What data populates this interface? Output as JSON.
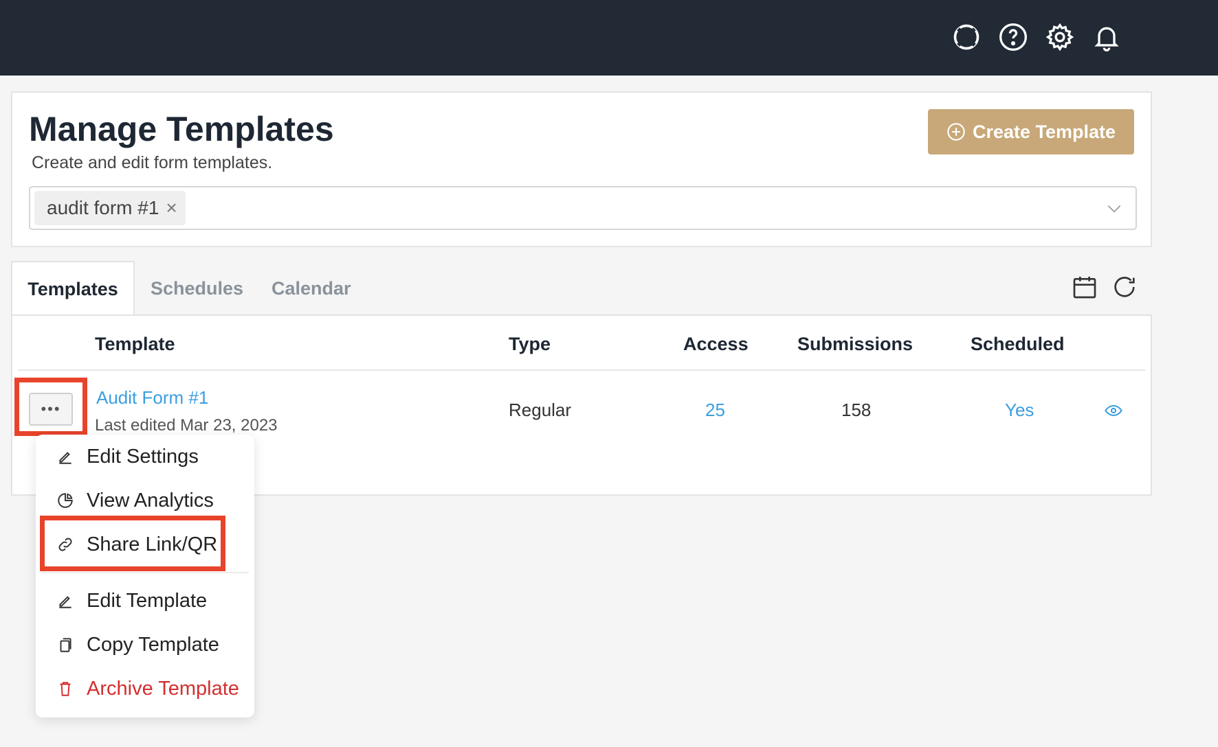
{
  "topbar": {
    "icons": [
      "lifebuoy-icon",
      "help-icon",
      "gear-icon",
      "bell-icon"
    ]
  },
  "header": {
    "title": "Manage Templates",
    "subtitle": "Create and edit form templates.",
    "create_button": "Create Template",
    "filter_chip": "audit form #1",
    "chip_remove": "×"
  },
  "tabs": [
    "Templates",
    "Schedules",
    "Calendar"
  ],
  "table": {
    "columns": [
      "Template",
      "Type",
      "Access",
      "Submissions",
      "Scheduled"
    ],
    "rows": [
      {
        "more": "•••",
        "name": "Audit Form #1",
        "edited": "Last edited Mar 23, 2023",
        "type": "Regular",
        "access": "25",
        "submissions": "158",
        "scheduled": "Yes"
      }
    ]
  },
  "menu": {
    "items": [
      "Edit Settings",
      "View Analytics",
      "Share Link/QR",
      "Edit Template",
      "Copy Template",
      "Archive Template"
    ]
  },
  "colors": {
    "topbar": "#212a35",
    "accent_button": "#c8a878",
    "link": "#3b9ee0",
    "danger": "#d32f2f",
    "highlight": "#e8432b"
  }
}
